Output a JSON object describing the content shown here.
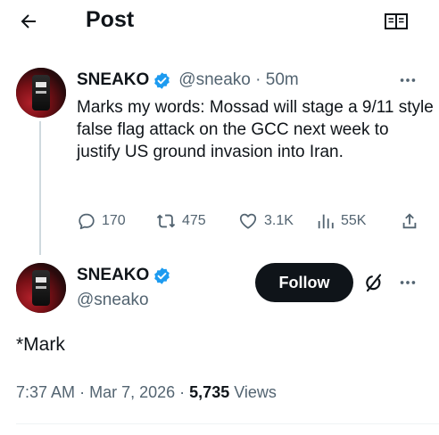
{
  "header": {
    "title": "Post",
    "back_icon": "arrow-left-icon",
    "reader_icon": "open-book-icon"
  },
  "parent_post": {
    "display_name": "SNEAKO",
    "handle": "@sneako",
    "separator": "·",
    "time": "50m",
    "text": "Marks my words: Mossad will stage a 9/11 style false flag attack on the GCC next week to justify US ground invasion into Iran.",
    "actions": {
      "replies": "170",
      "reposts": "475",
      "likes": "3.1K",
      "views": "55K"
    }
  },
  "reply_post": {
    "display_name": "SNEAKO",
    "handle": "@sneako",
    "follow_label": "Follow",
    "text": "*Mark",
    "time": "7:37 AM",
    "dot": "·",
    "date": "Mar 7, 2026",
    "views_count": "5,735",
    "views_label": "Views"
  },
  "colors": {
    "text_primary": "#0f1419",
    "text_secondary": "#536471",
    "verified_blue": "#1d9bf0",
    "follow_bg": "#0f1419",
    "divider": "#eff3f4"
  }
}
